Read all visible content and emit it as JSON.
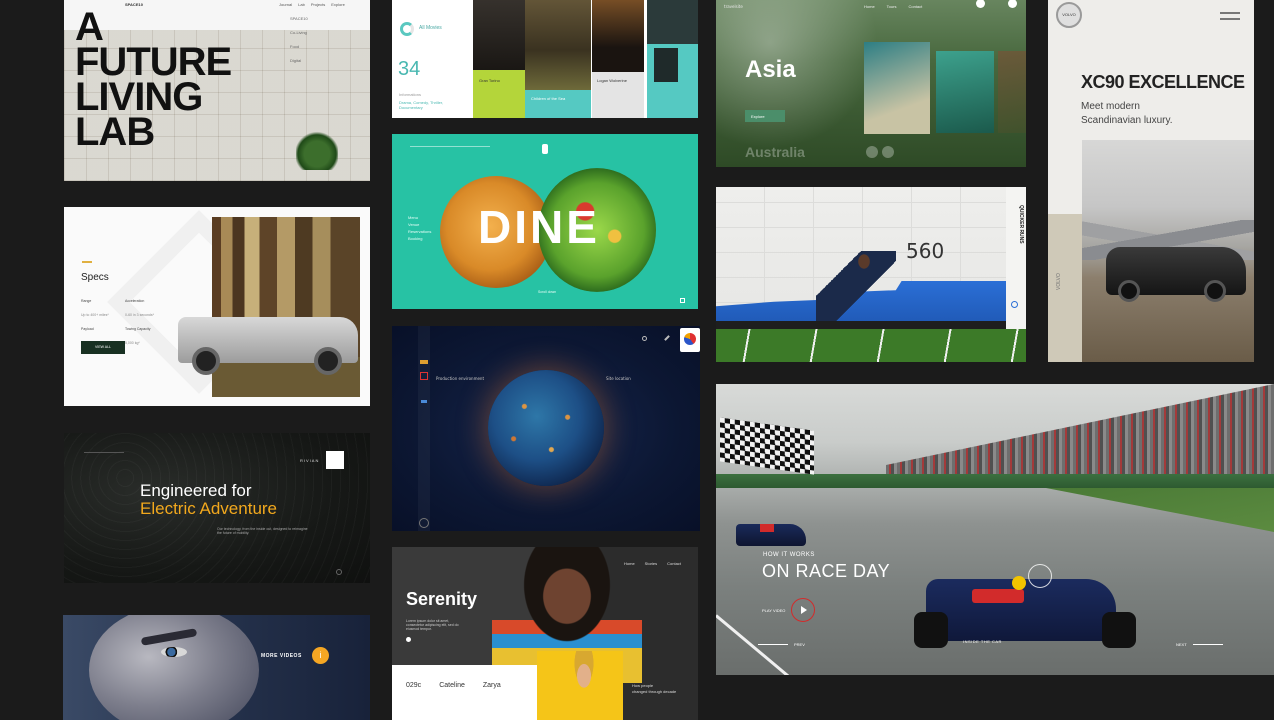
{
  "lab": {
    "title_lines": [
      "A",
      "FUTURE",
      "LIVING",
      "LAB"
    ],
    "brand": "SPACE10",
    "nav": [
      "Journal",
      "Lab",
      "Projects",
      "Explore"
    ],
    "side_text": [
      "SPACE10",
      "Co-Living",
      "Food",
      "Digital"
    ]
  },
  "media": {
    "count": "34",
    "label": "All Movies",
    "genre_text": "Drama, Comedy, Thriller, Documentary",
    "section": "Informations",
    "poster_captions": [
      "Gran Torino",
      "Children of the Sea",
      "Logan Wolverine"
    ]
  },
  "asia": {
    "brand": "travelsite",
    "title": "Asia",
    "subtitle": "Australia",
    "button": "Explore",
    "nav": [
      "Home",
      "Tours",
      "Contact"
    ]
  },
  "volvo": {
    "title": "XC90 EXCELLENCE",
    "subtitle_lines": [
      "Meet modern",
      "Scandinavian luxury."
    ],
    "logo": "VOLVO",
    "vertical": "VOLVO"
  },
  "rivian_specs": {
    "title": "Specs",
    "labels": [
      "Range",
      "Acceleration",
      "Payload",
      "Towing Capacity"
    ],
    "values": [
      "Up to 400+ miles*",
      "0-60 in 3 seconds*",
      "800kg*",
      "5,000 kg*"
    ],
    "button": "VIEW ALL"
  },
  "dine": {
    "title": "DINE",
    "menu": [
      "Menu",
      "Venue",
      "Reservations",
      "Booking"
    ],
    "footer": "Scroll down"
  },
  "sport": {
    "number": "560",
    "vertical": "QUICKER RUNS"
  },
  "globe": {
    "annotation": "Production environment",
    "annotation2": "Site location"
  },
  "rivian_dark": {
    "line1": "Engineered for",
    "line2": "Electric Adventure",
    "brand": "RIVIAN",
    "body": "Our technology, from the inside out, designed to reimagine the future of mobility."
  },
  "race": {
    "eyebrow": "HOW IT WORKS",
    "title": "ON RACE DAY",
    "play": "PLAY VIDEO",
    "inside": "INSIDE THE CAR",
    "prev": "PREV",
    "next": "NEXT"
  },
  "serenity": {
    "title": "Serenity",
    "body": "Lorem ipsum dolor sit amet, consectetur adipiscing elit, sed do eiusmod tempor.",
    "stats": [
      "029c",
      "Cateline",
      "Zarya"
    ],
    "side": [
      "How people",
      "changed through decade"
    ],
    "nav": [
      "Home",
      "Stories",
      "Contact"
    ]
  },
  "minion": {
    "label": "MORE VIDEOS"
  },
  "colors": {
    "background": "#1b1b1b",
    "dine_teal": "#27c2a4",
    "rivian_orange": "#f2a81d",
    "race_red": "#d22b2b",
    "serenity_yellow": "#f5c518",
    "media_lime": "#b4d53a",
    "media_teal": "#55c9c2"
  }
}
